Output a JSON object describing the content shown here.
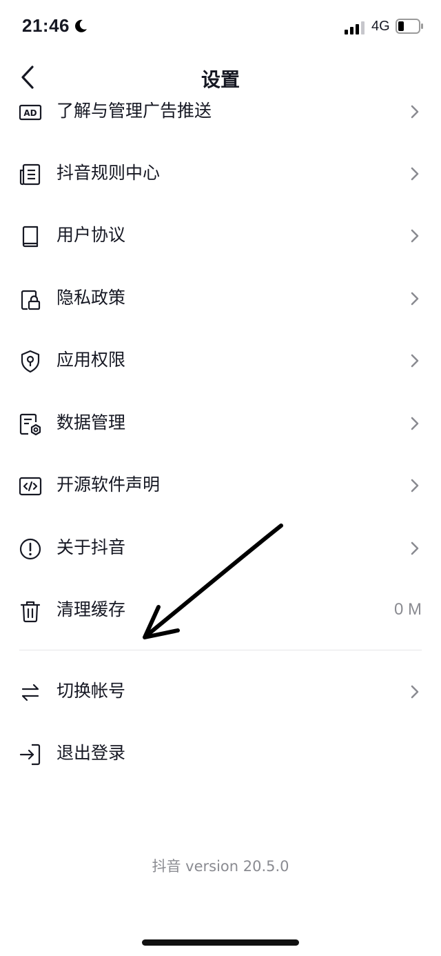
{
  "status_bar": {
    "time": "21:46",
    "network": "4G",
    "icons": [
      "moon-icon",
      "signal-icon",
      "battery-icon"
    ]
  },
  "header": {
    "title": "设置",
    "back_icon": "chevron-left-icon"
  },
  "menu": {
    "items": [
      {
        "label": "了解与管理广告推送",
        "icon": "ad-icon",
        "chevron": true
      },
      {
        "label": "抖音规则中心",
        "icon": "document-list-icon",
        "chevron": true
      },
      {
        "label": "用户协议",
        "icon": "book-icon",
        "chevron": true
      },
      {
        "label": "隐私政策",
        "icon": "privacy-lock-icon",
        "chevron": true
      },
      {
        "label": "应用权限",
        "icon": "shield-key-icon",
        "chevron": true
      },
      {
        "label": "数据管理",
        "icon": "data-settings-icon",
        "chevron": true
      },
      {
        "label": "开源软件声明",
        "icon": "code-icon",
        "chevron": true
      },
      {
        "label": "关于抖音",
        "icon": "info-circle-icon",
        "chevron": true
      },
      {
        "label": "清理缓存",
        "icon": "trash-icon",
        "value": "0 M"
      }
    ],
    "account_items": [
      {
        "label": "切换帐号",
        "icon": "switch-arrows-icon",
        "chevron": true
      },
      {
        "label": "退出登录",
        "icon": "logout-icon"
      }
    ]
  },
  "footer": {
    "version": "抖音 version 20.5.0"
  },
  "colors": {
    "text": "#161823",
    "secondary": "#8a8b91",
    "divider": "#e5e5e7"
  }
}
